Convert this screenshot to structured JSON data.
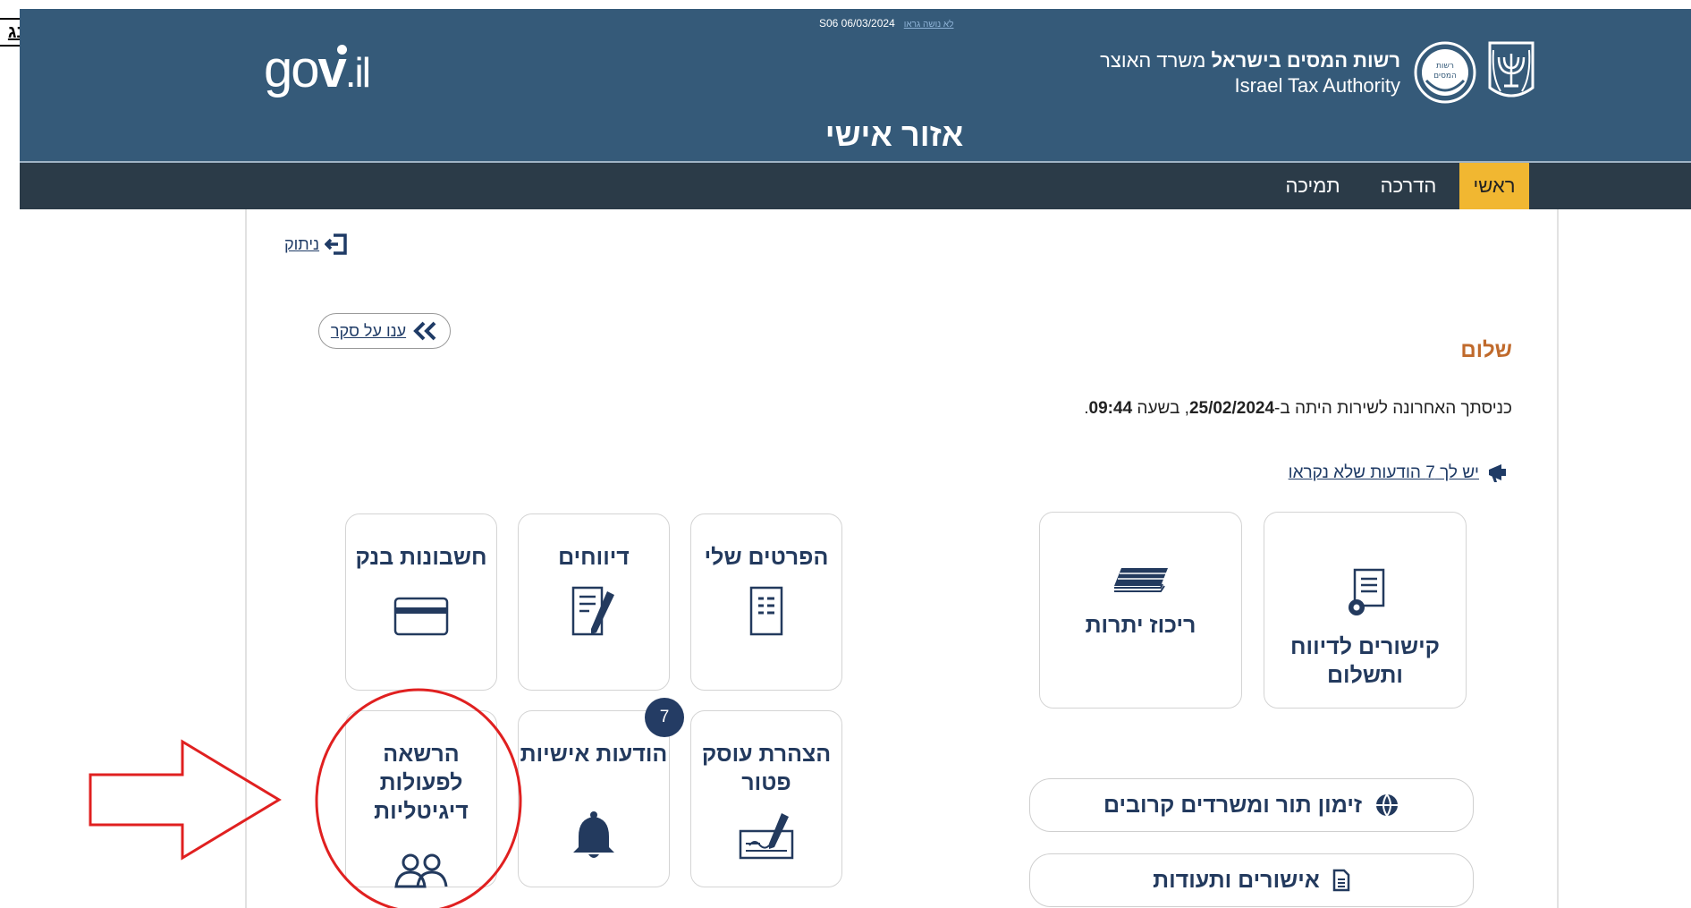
{
  "corner_tab": {
    "label": "נג"
  },
  "header": {
    "date": "S06 06/03/2024",
    "date_link": "לא נושה גראו",
    "logo_text": {
      "go": "go",
      "v": "v",
      "il": ".il"
    },
    "ita_name_bold": "רשות המסים בישראל",
    "ita_ministry": " משרד האוצר",
    "ita_english": "Israel Tax Authority",
    "title": "אזור אישי"
  },
  "nav": {
    "items": [
      {
        "label": "ראשי",
        "active": true
      },
      {
        "label": "הדרכה",
        "active": false
      },
      {
        "label": "תמיכה",
        "active": false
      }
    ]
  },
  "logout": {
    "label": "ניתוק",
    "icon": "logout-icon"
  },
  "survey": {
    "label": "ענו על סקר",
    "icon": "double-chevron-left-icon"
  },
  "greeting": "שלום",
  "last_login": {
    "prefix": "כניסתך האחרונה לשירות היתה ב-",
    "date": "25/02/2024",
    "middle": ", בשעה ",
    "time": "09:44",
    "suffix": "."
  },
  "messages_link": {
    "label": "יש לך 7 הודעות שלא נקראו",
    "icon": "megaphone-icon"
  },
  "tiles_left": [
    {
      "label": "הפרטים שלי",
      "icon": "document-list-icon"
    },
    {
      "label": "דיווחים",
      "icon": "document-pen-icon"
    },
    {
      "label": "חשבונות בנק",
      "icon": "credit-card-icon"
    },
    {
      "label": "הצהרת עוסק פטור",
      "icon": "signature-icon"
    },
    {
      "label": "הודעות אישיות",
      "icon": "bell-icon",
      "badge": "7"
    },
    {
      "label": "הרשאה לפעולות דיגיטליות",
      "icon": "users-icon"
    }
  ],
  "tiles_right": [
    {
      "label": "קישורים לדיווח ותשלום",
      "icon": "document-gear-icon"
    },
    {
      "label": "ריכוז יתרות",
      "icon": "banknotes-icon"
    }
  ],
  "pills": [
    {
      "label": "זימון תור ומשרדים קרובים",
      "icon": "globe-icon"
    },
    {
      "label": "אישורים ותעודות",
      "icon": "document-icon"
    }
  ],
  "colors": {
    "header": "#355a79",
    "navbar": "#2b3b48",
    "nav_active": "#f1b731",
    "tile_text": "#233a5e",
    "greeting": "#c06a2c",
    "annotation": "#e02020"
  }
}
